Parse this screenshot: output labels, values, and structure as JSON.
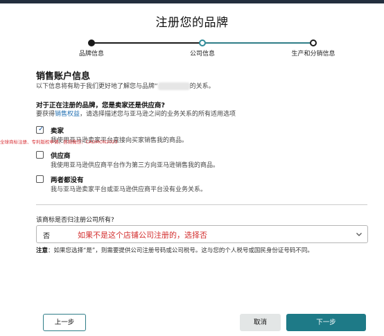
{
  "header": {
    "title": "注册您的品牌"
  },
  "stepper": {
    "steps": [
      {
        "label": "品牌信息",
        "state": "done"
      },
      {
        "label": "公司信息",
        "state": "current"
      },
      {
        "label": "生产和分销信息",
        "state": "todo"
      }
    ]
  },
  "section": {
    "heading": "销售账户信息",
    "desc_before": "以下信息将有助于我们更好地了解您与品牌“",
    "desc_after": "的关系。"
  },
  "question": {
    "heading": "对于正在注册的品牌，您是卖家还是供应商?",
    "help_before": "要获得",
    "help_link": "销售权益",
    "help_after": "，请选择描述您与亚马逊之间的业务关系的所有适用选项"
  },
  "options": [
    {
      "label": "卖家",
      "desc": "我使用亚马逊卖家平台直接向买家销售我的商品。",
      "checked": true
    },
    {
      "label": "供应商",
      "desc": "我使用亚马逊供应商平台作为第三方向亚马逊销售我的商品。",
      "checked": false
    },
    {
      "label": "两者都没有",
      "desc": "我与亚马逊卖家平台或亚马逊供应商平台没有业务关系。",
      "checked": false
    }
  ],
  "watermark": "全球商标注册、专利版权申请，咨询微信：CADMON2023",
  "ownership": {
    "label": "该商标是否归注册公司所有?",
    "selected": "否",
    "annotation": "如果不是这个店铺公司注册的，选择否",
    "note_prefix": "注意",
    "note_text": "：如果您选择“是”，则需要提供公司注册号码或公司税号。这与您的个人税号或国民身份证号码不同。"
  },
  "buttons": {
    "prev": "上一步",
    "cancel": "取消",
    "next": "下一步"
  },
  "colors": {
    "accent": "#1e7a87",
    "topbar": "#232f3e",
    "annotation_red": "#d32f2f",
    "link": "#1f6fb2"
  }
}
